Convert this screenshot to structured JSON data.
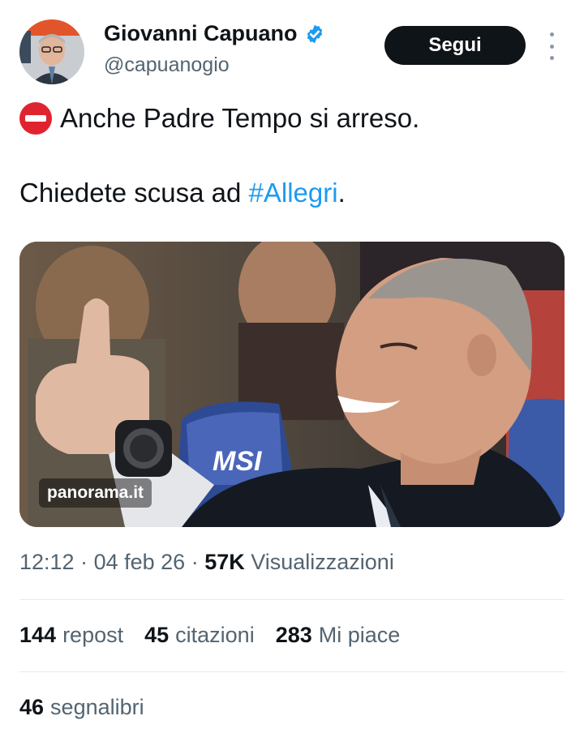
{
  "author": {
    "name": "Giovanni Capuano",
    "handle": "@capuanogio",
    "verified_color": "#1d9bf0"
  },
  "actions": {
    "follow_label": "Segui"
  },
  "tweet": {
    "line1": "Anche Padre Tempo si arreso.",
    "line2_prefix": "Chiedete scusa ad ",
    "hashtag": "#Allegri",
    "line2_suffix": "."
  },
  "media": {
    "watermark": "panorama.it",
    "seat_text": "MSI"
  },
  "meta": {
    "time": "12:12",
    "sep1": " · ",
    "date": "04 feb 26",
    "sep2": " · ",
    "views": "57K",
    "views_label": " Visualizzazioni"
  },
  "stats": {
    "reposts": "144",
    "reposts_label": "repost",
    "quotes": "45",
    "quotes_label": "citazioni",
    "likes": "283",
    "likes_label": "Mi piace",
    "bookmarks": "46",
    "bookmarks_label": "segnalibri"
  },
  "colors": {
    "accent": "#1d9bf0",
    "text": "#0f1419",
    "muted": "#536471",
    "stop_sign": "#e0242f"
  }
}
